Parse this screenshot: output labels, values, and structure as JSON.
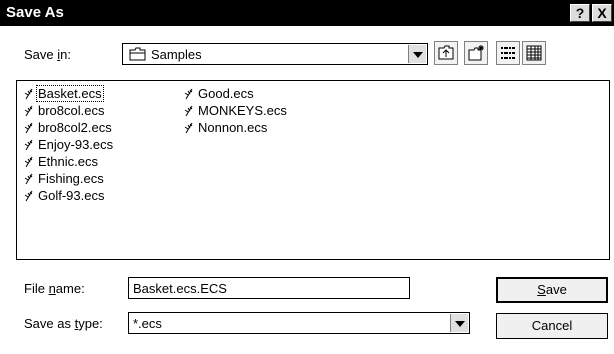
{
  "window": {
    "title": "Save As",
    "help_label": "?",
    "close_label": "X"
  },
  "save_in": {
    "label_pre": "Save ",
    "label_u": "i",
    "label_post": "n:",
    "value": "Samples"
  },
  "toolbar": {
    "icons": [
      "up-one-level-icon",
      "new-folder-icon",
      "list-view-icon",
      "details-view-icon"
    ]
  },
  "files": {
    "column1": [
      "Basket.ecs",
      "bro8col.ecs",
      "bro8col2.ecs",
      "Enjoy-93.ecs",
      "Ethnic.ecs",
      "Fishing.ecs",
      "Golf-93.ecs"
    ],
    "column2": [
      "Good.ecs",
      "MONKEYS.ecs",
      "Nonnon.ecs"
    ],
    "selected": "Basket.ecs"
  },
  "file_name": {
    "label_pre": "File ",
    "label_u": "n",
    "label_post": "ame:",
    "value": "Basket.ecs.ECS"
  },
  "save_as_type": {
    "label_pre": "Save as ",
    "label_u": "t",
    "label_post": "ype:",
    "value": "*.ecs"
  },
  "buttons": {
    "save_u": "S",
    "save_post": "ave",
    "cancel": "Cancel"
  }
}
